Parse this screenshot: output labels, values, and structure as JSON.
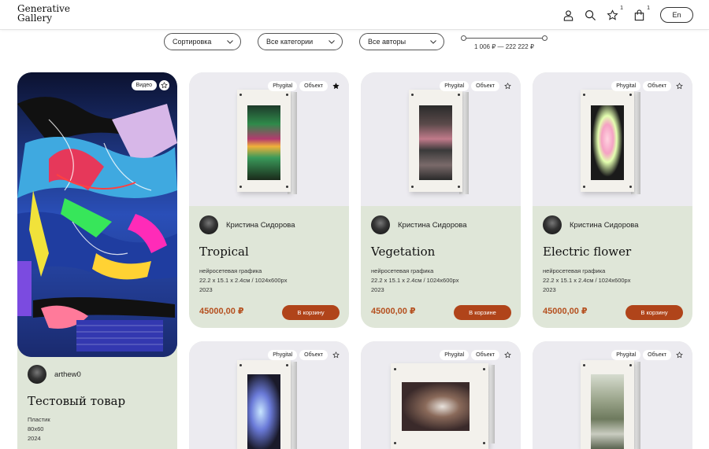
{
  "header": {
    "logo_line1": "Generative",
    "logo_line2": "Gallery",
    "favorites_count": "1",
    "cart_count": "1",
    "lang_label": "En"
  },
  "filters": {
    "sort_label": "Сортировка",
    "categories_label": "Все категории",
    "authors_label": "Все авторы",
    "price_range": "1 006 ₽ — 222 222 ₽"
  },
  "featured": {
    "badge": "Видео",
    "author": "arthew0",
    "title": "Тестовый товар",
    "material": "Пластик",
    "size": "80x60",
    "year": "2024"
  },
  "products": [
    {
      "badge1": "Phygital",
      "badge2": "Объект",
      "favorited": true,
      "author": "Кристина Сидорова",
      "title": "Tropical",
      "category": "нейросетевая графика",
      "dimensions": "22.2 x 15.1 x 2.4см / 1024x600px",
      "year": "2023",
      "price": "45000,00 ₽",
      "button": "В корзину"
    },
    {
      "badge1": "Phygital",
      "badge2": "Объект",
      "favorited": false,
      "author": "Кристина Сидорова",
      "title": "Vegetation",
      "category": "нейросетевая графика",
      "dimensions": "22.2 x 15.1 x 2.4см / 1024x600px",
      "year": "2023",
      "price": "45000,00 ₽",
      "button": "В корзине"
    },
    {
      "badge1": "Phygital",
      "badge2": "Объект",
      "favorited": false,
      "author": "Кристина Сидорова",
      "title": "Electric flower",
      "category": "нейросетевая графика",
      "dimensions": "22.2 x 15.1 x 2.4см / 1024x600px",
      "year": "2023",
      "price": "45000,00 ₽",
      "button": "В корзину"
    },
    {
      "badge1": "Phygital",
      "badge2": "Объект",
      "favorited": false
    },
    {
      "badge1": "Phygital",
      "badge2": "Объект",
      "favorited": false
    },
    {
      "badge1": "Phygital",
      "badge2": "Объект",
      "favorited": false
    }
  ]
}
